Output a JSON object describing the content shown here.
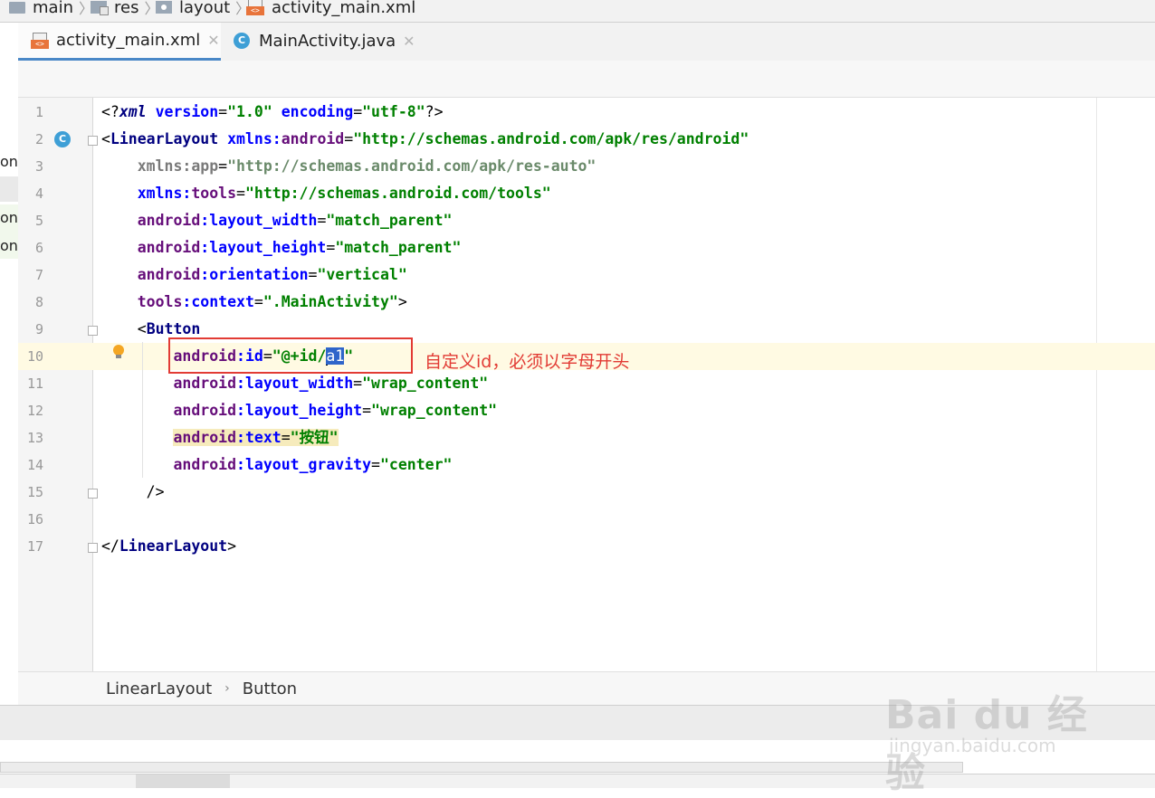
{
  "breadcrumb_top": {
    "items": [
      "main",
      "res",
      "layout",
      "activity_main.xml"
    ]
  },
  "tabs": [
    {
      "label": "activity_main.xml",
      "icon": "xml-file-icon",
      "active": true,
      "close": "✕"
    },
    {
      "label": "MainActivity.java",
      "icon": "java-class-icon",
      "active": false,
      "close": "✕"
    }
  ],
  "left_strip_text": [
    "on",
    "on",
    "on"
  ],
  "editor": {
    "current_line": 10,
    "lines": [
      {
        "n": "1"
      },
      {
        "n": "2"
      },
      {
        "n": "3"
      },
      {
        "n": "4"
      },
      {
        "n": "5"
      },
      {
        "n": "6"
      },
      {
        "n": "7"
      },
      {
        "n": "8"
      },
      {
        "n": "9"
      },
      {
        "n": "10"
      },
      {
        "n": "11"
      },
      {
        "n": "12"
      },
      {
        "n": "13"
      },
      {
        "n": "14"
      },
      {
        "n": "15"
      },
      {
        "n": "16"
      },
      {
        "n": "17"
      }
    ],
    "code": {
      "l1_open": "<?",
      "l1_tag": "xml",
      "l1_attr1": " version",
      "l1_eq1": "=",
      "l1_val1": "\"1.0\"",
      "l1_attr2": " encoding",
      "l1_eq2": "=",
      "l1_val2": "\"utf-8\"",
      "l1_close": "?>",
      "l2_open": "<",
      "l2_tag": "LinearLayout",
      "l2_sp": " ",
      "l2_attr": "xmlns:",
      "l2_ns": "android",
      "l2_eq": "=",
      "l2_val": "\"http://schemas.android.com/apk/res/android\"",
      "l3_attr": "    xmlns:app",
      "l3_eq": "=",
      "l3_val": "\"http://schemas.android.com/apk/res-auto\"",
      "l4_attr": "    xmlns:",
      "l4_ns": "tools",
      "l4_eq": "=",
      "l4_val": "\"http://schemas.android.com/tools\"",
      "l5_ns": "android",
      "l5_attr": ":layout_width",
      "l5_eq": "=",
      "l5_val": "\"match_parent\"",
      "l6_ns": "android",
      "l6_attr": ":layout_height",
      "l6_eq": "=",
      "l6_val": "\"match_parent\"",
      "l7_ns": "android",
      "l7_attr": ":orientation",
      "l7_eq": "=",
      "l7_val": "\"vertical\"",
      "l8_ns": "tools",
      "l8_attr": ":context",
      "l8_eq": "=",
      "l8_val": "\".MainActivity\"",
      "l8_close": ">",
      "l9_open": "<",
      "l9_tag": "Button",
      "l10_ns": "android",
      "l10_attr": ":id",
      "l10_eq": "=",
      "l10_val_pre": "\"@+id/",
      "l10_val_sel": "a1",
      "l10_val_post": "\"",
      "l11_ns": "android",
      "l11_attr": ":layout_width",
      "l11_eq": "=",
      "l11_val": "\"wrap_content\"",
      "l12_ns": "android",
      "l12_attr": ":layout_height",
      "l12_eq": "=",
      "l12_val": "\"wrap_content\"",
      "l13_ns": "android",
      "l13_attr": ":text",
      "l13_eq": "=",
      "l13_val": "\"按钮\"",
      "l14_ns": "android",
      "l14_attr": ":layout_gravity",
      "l14_eq": "=",
      "l14_val": "\"center\"",
      "l15": "/>",
      "l17_open": "</",
      "l17_tag": "LinearLayout",
      "l17_close": ">"
    }
  },
  "annotation": {
    "text": "自定义id，必须以字母开头",
    "color": "#e23b34"
  },
  "bottom_breadcrumb": {
    "items": [
      "LinearLayout",
      "Button"
    ],
    "separator": "›"
  },
  "watermark": {
    "main": "Bai du 经验",
    "sub": "jingyan.baidu.com"
  },
  "colors": {
    "tag": "#000080",
    "attribute": "#0000ff",
    "namespace": "#660e7a",
    "value": "#008000",
    "selection": "#2f65ca",
    "current_line": "#fffae3",
    "active_tab_underline": "#4a88c7"
  }
}
